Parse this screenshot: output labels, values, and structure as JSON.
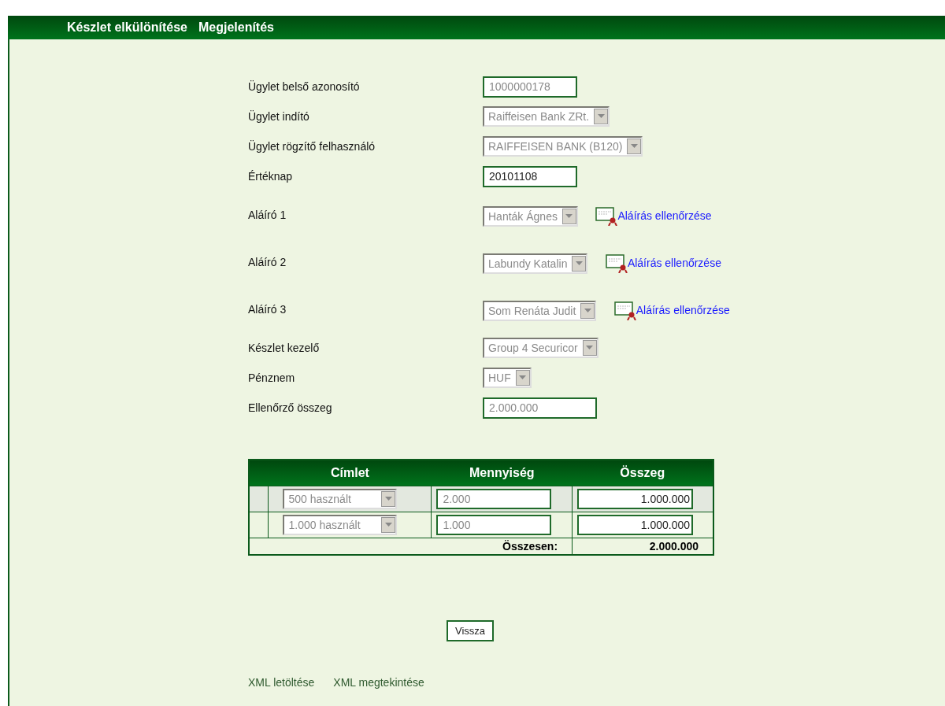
{
  "header": {
    "title": "Készlet elkülönítése",
    "subtitle": "Megjelenítés"
  },
  "fields": [
    {
      "label": "Ügylet belső azonosító",
      "kind": "input",
      "value": "1000000178",
      "disabled": true
    },
    {
      "label": "Ügylet indító",
      "kind": "select",
      "value": "Raiffeisen Bank ZRt.",
      "disabled": true
    },
    {
      "label": "Ügylet rögzítő felhasználó",
      "kind": "select",
      "value": "RAIFFEISEN BANK (B120)",
      "disabled": true
    },
    {
      "label": "Értéknap",
      "kind": "input",
      "value": "20101108",
      "disabled": false
    },
    {
      "label": "Aláíró 1",
      "kind": "signer",
      "value": "Hanták Ágnes",
      "disabled": true,
      "link": "Aláírás ellenőrzése"
    },
    {
      "label": "Aláíró 2",
      "kind": "signer",
      "value": "Labundy Katalin",
      "disabled": true,
      "link": "Aláírás ellenőrzése"
    },
    {
      "label": "Aláíró 3",
      "kind": "signer",
      "value": "Som Renáta Judit",
      "disabled": true,
      "link": "Aláírás ellenőrzése"
    },
    {
      "label": "Készlet kezelő",
      "kind": "select",
      "value": "Group 4 Securicor",
      "disabled": true
    },
    {
      "label": "Pénznem",
      "kind": "select",
      "value": "HUF",
      "disabled": true
    },
    {
      "label": "Ellenőrző összeg",
      "kind": "input",
      "value": "2.000.000",
      "disabled": true
    }
  ],
  "table": {
    "columns": [
      "Címlet",
      "Mennyiség",
      "Összeg"
    ],
    "rows": [
      {
        "denomination": "500 használt",
        "quantity": "2.000",
        "amount": "1.000.000"
      },
      {
        "denomination": "1.000 használt",
        "quantity": "1.000",
        "amount": "1.000.000"
      }
    ],
    "total_label": "Összesen:",
    "total": "2.000.000"
  },
  "back_button": "Vissza",
  "links": [
    "XML letöltése",
    "XML megtekintése"
  ]
}
